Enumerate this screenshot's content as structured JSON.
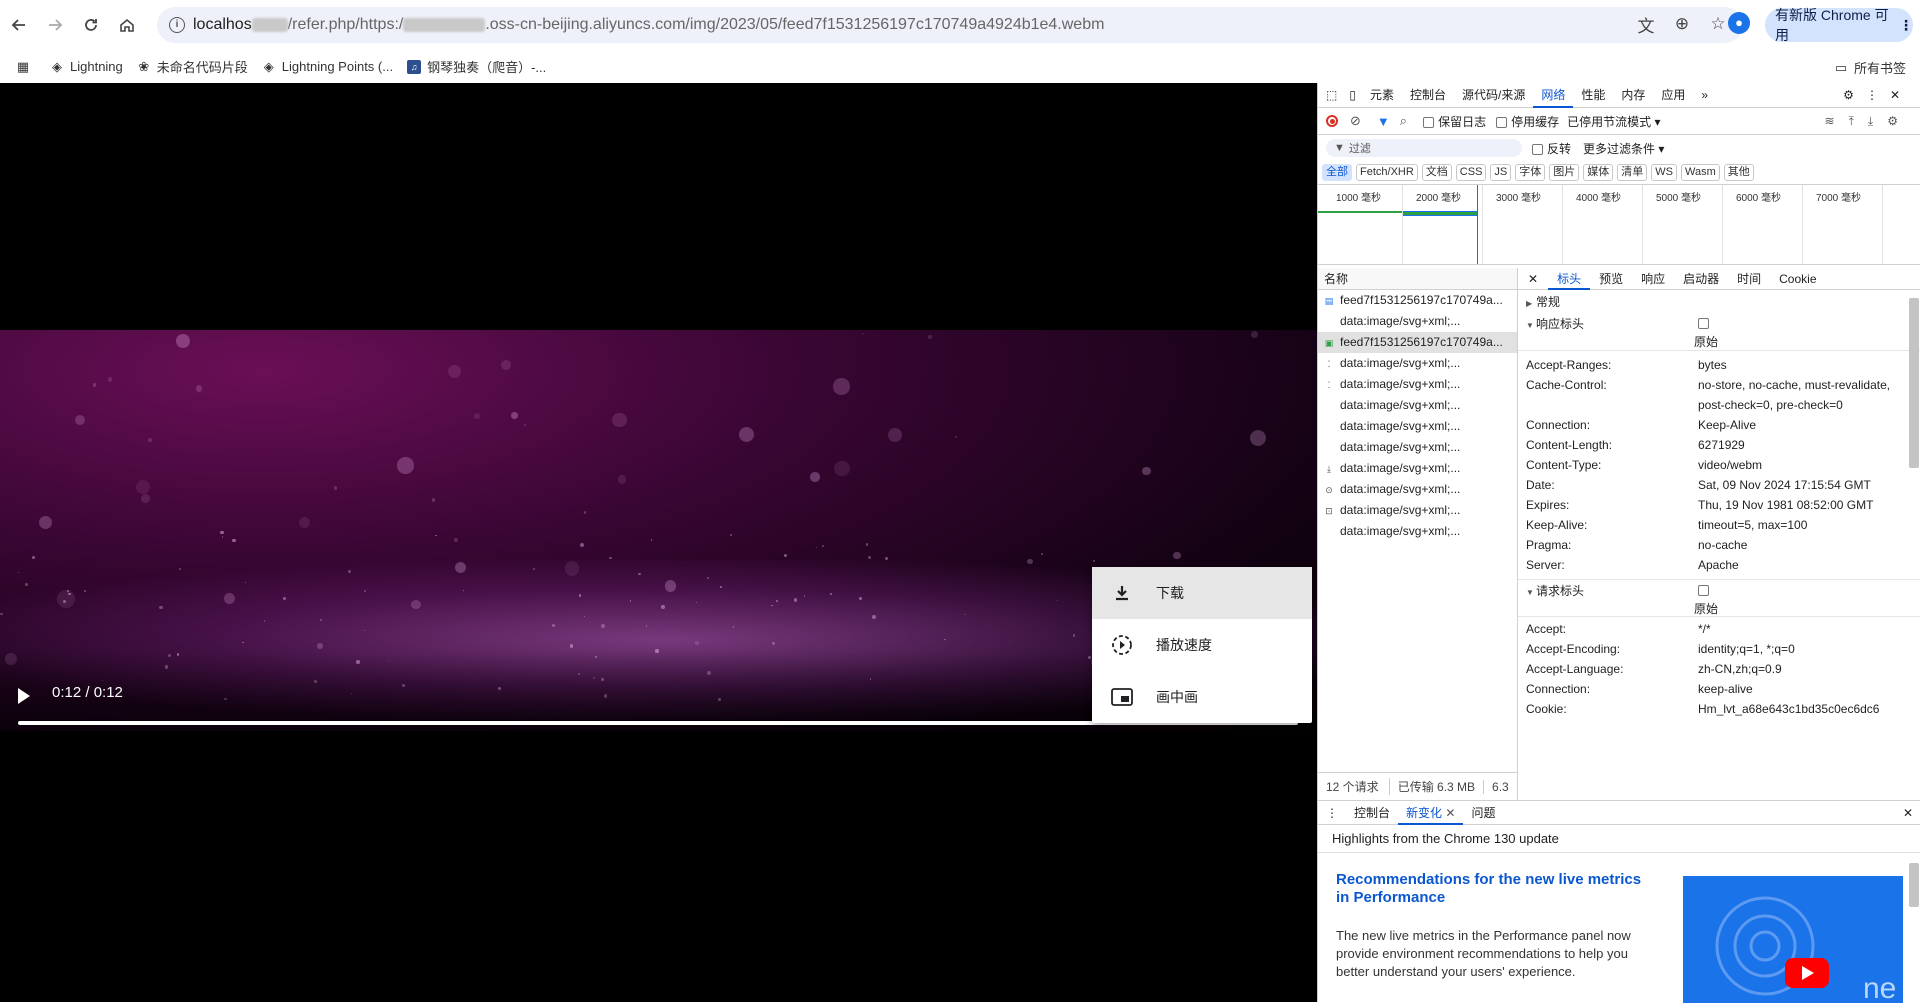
{
  "browser": {
    "url_prefix": "localhos",
    "url_mid": "/refer.php/https:/",
    "url_suffix": ".oss-cn-beijing.aliyuncs.com/img/2023/05/feed7f1531256197c170749a4924b1e4.webm",
    "update_label": "有新版 Chrome 可用",
    "all_bookmarks": "所有书签",
    "bookmarks": [
      "Lightning",
      "未命名代码片段",
      "Lightning Points (...",
      "钢琴独奏（爬音）-..."
    ]
  },
  "video": {
    "time": "0:12 / 0:12",
    "progress": 1.0,
    "menu": [
      "下载",
      "播放速度",
      "画中画"
    ]
  },
  "devtools": {
    "tabs": [
      "元素",
      "控制台",
      "源代码/来源",
      "网络",
      "性能",
      "内存",
      "应用"
    ],
    "active_tab": "网络",
    "toolbar": {
      "preserve_log": "保留日志",
      "disable_cache": "停用缓存",
      "throttle": "已停用节流模式"
    },
    "filter": {
      "placeholder": "过滤",
      "invert": "反转",
      "more": "更多过滤条件"
    },
    "chips": [
      "全部",
      "Fetch/XHR",
      "文档",
      "CSS",
      "JS",
      "字体",
      "图片",
      "媒体",
      "清单",
      "WS",
      "Wasm",
      "其他"
    ],
    "ticks": [
      "1000 毫秒",
      "2000 毫秒",
      "3000 毫秒",
      "4000 毫秒",
      "5000 毫秒",
      "6000 毫秒",
      "7000 毫秒"
    ],
    "name_header": "名称",
    "requests": [
      "feed7f1531256197c170749a...",
      "data:image/svg+xml;...",
      "feed7f1531256197c170749a...",
      "data:image/svg+xml;...",
      "data:image/svg+xml;...",
      "data:image/svg+xml;...",
      "data:image/svg+xml;...",
      "data:image/svg+xml;...",
      "data:image/svg+xml;...",
      "data:image/svg+xml;...",
      "data:image/svg+xml;...",
      "data:image/svg+xml;..."
    ],
    "footer": {
      "count": "12 个请求",
      "transferred": "已传输 6.3 MB",
      "res": "6.3"
    },
    "detail_tabs": [
      "标头",
      "预览",
      "响应",
      "启动器",
      "时间",
      "Cookie"
    ],
    "sections": {
      "general": "常规",
      "response": "响应标头",
      "request": "请求标头",
      "raw": "原始"
    },
    "response_headers": [
      {
        "k": "Accept-Ranges:",
        "v": "bytes"
      },
      {
        "k": "Cache-Control:",
        "v": "no-store, no-cache, must-revalidate, post-check=0, pre-check=0"
      },
      {
        "k": "Connection:",
        "v": "Keep-Alive"
      },
      {
        "k": "Content-Length:",
        "v": "6271929"
      },
      {
        "k": "Content-Type:",
        "v": "video/webm"
      },
      {
        "k": "Date:",
        "v": "Sat, 09 Nov 2024 17:15:54 GMT"
      },
      {
        "k": "Expires:",
        "v": "Thu, 19 Nov 1981 08:52:00 GMT"
      },
      {
        "k": "Keep-Alive:",
        "v": "timeout=5, max=100"
      },
      {
        "k": "Pragma:",
        "v": "no-cache"
      },
      {
        "k": "Server:",
        "v": "Apache"
      }
    ],
    "request_headers": [
      {
        "k": "Accept:",
        "v": "*/*"
      },
      {
        "k": "Accept-Encoding:",
        "v": "identity;q=1, *;q=0"
      },
      {
        "k": "Accept-Language:",
        "v": "zh-CN,zh;q=0.9"
      },
      {
        "k": "Connection:",
        "v": "keep-alive"
      },
      {
        "k": "Cookie:",
        "v": "Hm_lvt_a68e643c1bd35c0ec6dc6"
      }
    ],
    "drawer": {
      "tabs": [
        "控制台",
        "新变化",
        "问题"
      ],
      "highlight": "Highlights from the Chrome 130 update",
      "title": "Recommendations for the new live metrics in Performance",
      "body": "The new live metrics in the Performance panel now provide environment recommendations to help you better understand your users' experience."
    }
  }
}
